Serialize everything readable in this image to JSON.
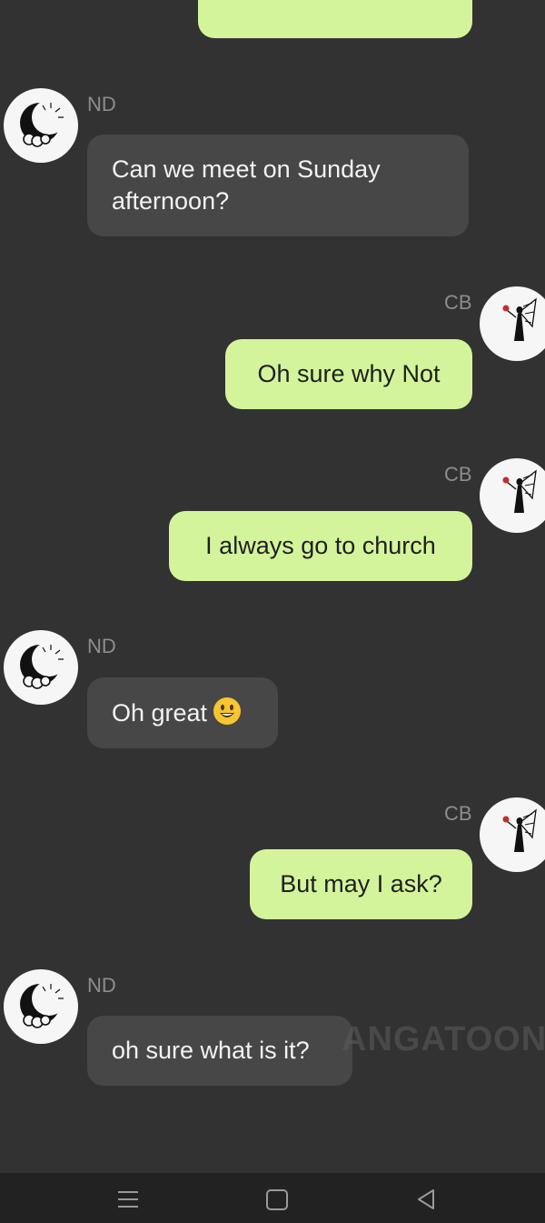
{
  "messages": [
    {
      "sender": "ND",
      "text": "Can we meet on Sunday afternoon?"
    },
    {
      "sender": "CB",
      "text": "Oh sure why Not"
    },
    {
      "sender": "CB",
      "text": "I always go to church"
    },
    {
      "sender": "ND",
      "text": "Oh great",
      "emoji": "smiley-emoji"
    },
    {
      "sender": "CB",
      "text": "But may I ask?"
    },
    {
      "sender": "ND",
      "text": "oh sure what is it?"
    }
  ],
  "watermark": "ANGATOON",
  "colors": {
    "background": "#323232",
    "incoming_bubble": "#474747",
    "outgoing_bubble": "#d4f49c",
    "nav_bar": "#222222"
  },
  "icons": {
    "nd_avatar": "crescent-moon-clouds-icon",
    "cb_avatar": "fairy-with-rose-icon",
    "nav": [
      "menu-icon",
      "home-icon",
      "back-icon"
    ]
  }
}
